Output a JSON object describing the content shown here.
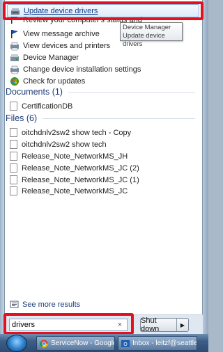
{
  "programs": {
    "items": [
      {
        "label": "Update device drivers",
        "icon": "device-driver-icon"
      },
      {
        "label": "Review your computer's status and",
        "icon": "action-center-flag-icon"
      },
      {
        "label": "View message archive",
        "icon": "action-center-flag-icon"
      },
      {
        "label": "View devices and printers",
        "icon": "devices-printers-icon"
      },
      {
        "label": "Device Manager",
        "icon": "device-manager-icon"
      },
      {
        "label": "Change device installation settings",
        "icon": "devices-printers-icon"
      },
      {
        "label": "Check for updates",
        "icon": "windows-update-icon"
      }
    ],
    "tooltip": {
      "line1": "Device Manager",
      "line2": "Update device drivers"
    }
  },
  "documents": {
    "heading": "Documents (1)",
    "items": [
      {
        "label": "CertificationDB"
      }
    ]
  },
  "files": {
    "heading": "Files (6)",
    "items": [
      {
        "label": "oitchdnlv2sw2 show tech - Copy"
      },
      {
        "label": "oitchdnlv2sw2 show tech"
      },
      {
        "label": "Release_Note_NetworkMS_JH"
      },
      {
        "label": "Release_Note_NetworkMS_JC (2)"
      },
      {
        "label": "Release_Note_NetworkMS_JC (1)"
      },
      {
        "label": "Release_Note_NetworkMS_JC"
      }
    ]
  },
  "see_more": {
    "label": "See more results"
  },
  "search": {
    "value": "drivers",
    "clear_glyph": "×"
  },
  "shutdown": {
    "label": "Shut down",
    "arrow_glyph": "▶"
  },
  "taskbar": {
    "buttons": [
      {
        "label": "ServiceNow - Google...",
        "icon": "chrome-icon"
      },
      {
        "label": "Inbox - leitzf@seattle...",
        "icon": "outlook-icon"
      }
    ]
  },
  "colors": {
    "highlight_border": "#e5101d",
    "group_heading": "#1e3c7a",
    "selection_border": "#8fb4de"
  }
}
